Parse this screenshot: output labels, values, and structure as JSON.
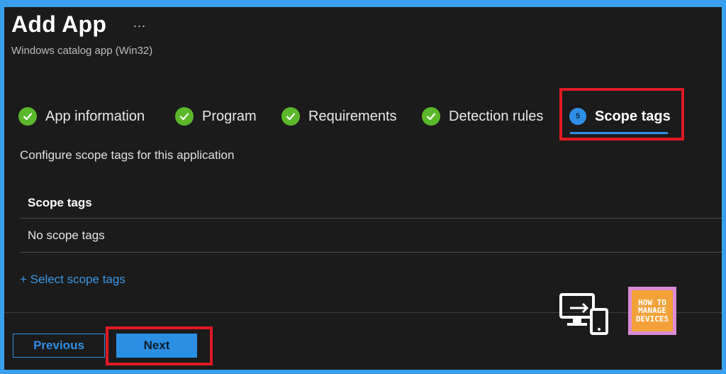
{
  "header": {
    "title": "Add App",
    "more": "...",
    "subtitle": "Windows catalog app (Win32)"
  },
  "steps": [
    {
      "label": "App information",
      "status": "complete"
    },
    {
      "label": "Program",
      "status": "complete"
    },
    {
      "label": "Requirements",
      "status": "complete"
    },
    {
      "label": "Detection rules",
      "status": "complete"
    },
    {
      "label": "Scope tags",
      "status": "active",
      "number": "5"
    }
  ],
  "content": {
    "description": "Configure scope tags for this application",
    "table_header": "Scope tags",
    "table_empty": "No scope tags",
    "select_link": "+ Select scope tags"
  },
  "footer": {
    "previous_label": "Previous",
    "next_label": "Next"
  },
  "watermark": {
    "line1": "HOW TO",
    "line2": "MANAGE",
    "line3": "DEVICES"
  },
  "colors": {
    "background": "#1b1b1b",
    "accent": "#2f8fe6",
    "success": "#5bb82a",
    "highlight": "#e01a22"
  }
}
